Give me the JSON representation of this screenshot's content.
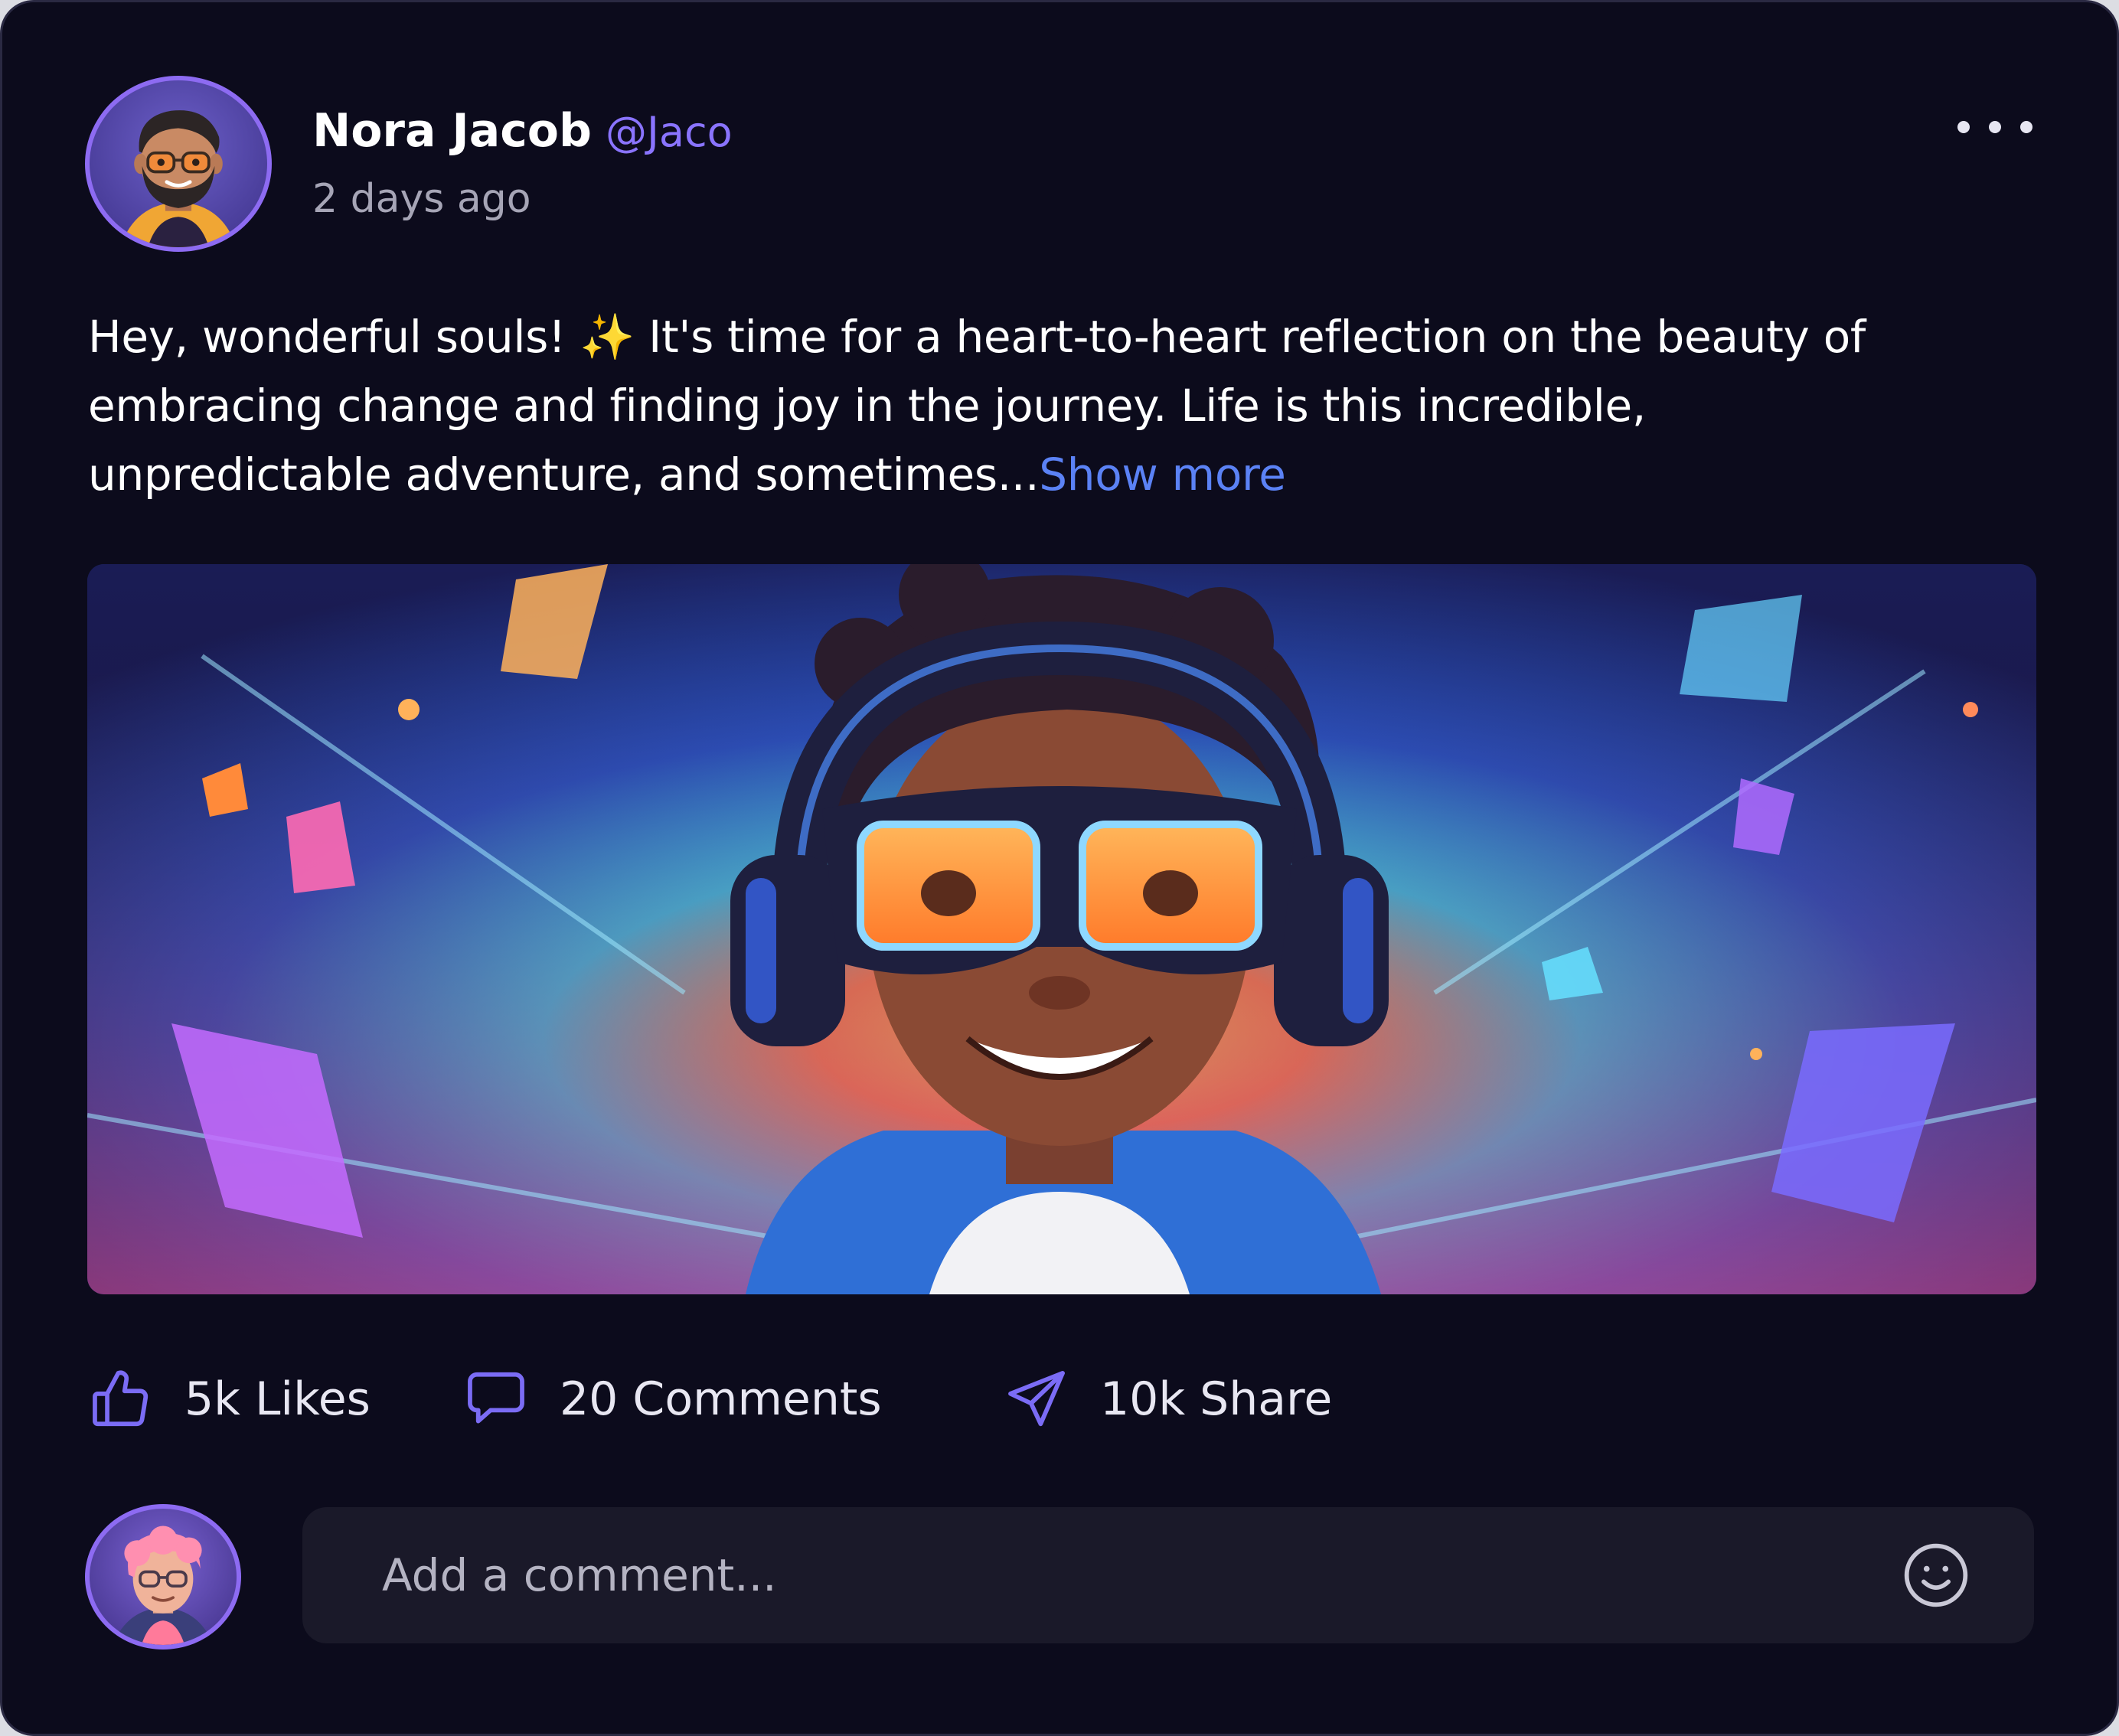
{
  "post": {
    "author": {
      "name": "Nora Jacob",
      "handle": "@Jaco",
      "avatar_icon": "bearded-man-avatar-icon"
    },
    "time": "2 days ago",
    "more_icon": "more-horizontal-icon",
    "text_lines": [
      "Hey, wonderful souls! ✨ It's time for a heart-to-heart reflection on the beauty of",
      "embracing change and finding joy in the journey. Life is this incredible,",
      "unpredictable adventure, and sometimes..."
    ],
    "show_more": "Show more",
    "image_icon": "boy-with-headphones-illustration"
  },
  "actions": {
    "likes": {
      "label": "5k Likes",
      "icon": "thumbs-up-icon"
    },
    "comments": {
      "label": "20 Comments",
      "icon": "comment-bubble-icon"
    },
    "share": {
      "label": "10k Share",
      "icon": "send-icon"
    }
  },
  "comment_bar": {
    "placeholder": "Add a comment...",
    "value": "",
    "avatar_icon": "user-avatar-icon",
    "emoji_icon": "smiley-face-icon"
  },
  "colors": {
    "background": "#0c0b1c",
    "accent_handle": "#8a74ff",
    "link": "#5b82f5",
    "icon_stroke": "#7b6cf5",
    "muted_text": "#a6a5b6",
    "input_background": "#1a1929"
  }
}
